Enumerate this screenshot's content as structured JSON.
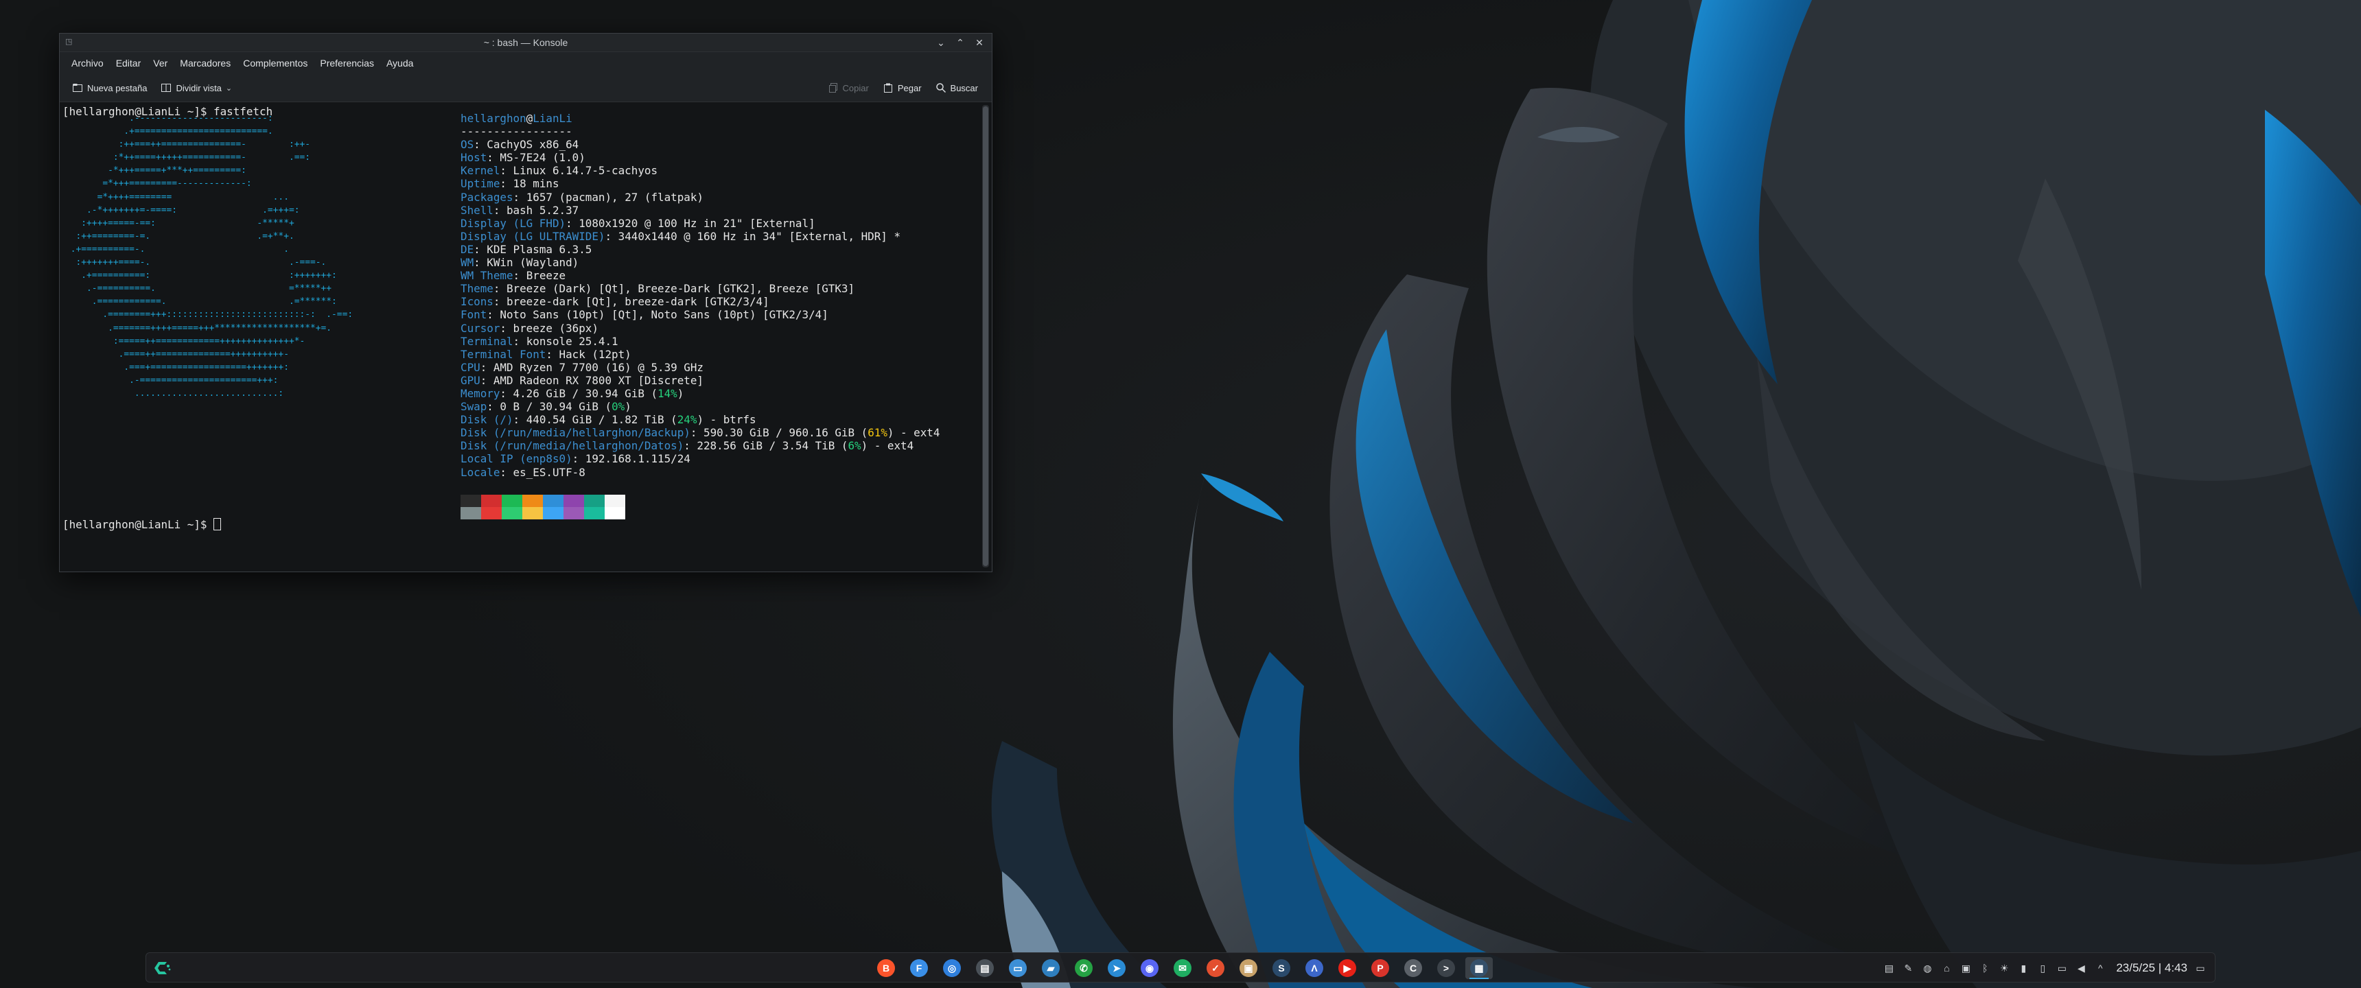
{
  "window": {
    "title": "~ : bash — Konsole",
    "menu": [
      "Archivo",
      "Editar",
      "Ver",
      "Marcadores",
      "Complementos",
      "Preferencias",
      "Ayuda"
    ],
    "toolbar": {
      "new_tab": "Nueva pestaña",
      "split_view": "Dividir vista",
      "copy": "Copiar",
      "paste": "Pegar",
      "search": "Buscar"
    }
  },
  "terminal": {
    "prompt1": "[hellarghon@LianLi ~]$ fastfetch",
    "prompt2": "[hellarghon@LianLi ~]$ ",
    "logo": [
      "            .-------------------------:",
      "           .+=========================.",
      "          :++===++===============-        :++-",
      "         :*++====+++++===========-        .==:",
      "        -*+++=====+***++=========:",
      "       =*+++=========-------------:",
      "      =*++++========                   ...",
      "    .-*+++++++=-====:                .=+++=:",
      "   :++++=====-==:                   -*****+",
      "  :++========-=.                    .=+**+.",
      " .+==========-.                          .",
      "  :+++++++====-.                          .-===-.",
      "   .+==========:                          :+++++++:",
      "    .-==========.                         =*****++",
      "     .============.                       .=******:",
      "       .========+++::::::::::::::::::::::::::-:  .-==:",
      "        .=======++++=====+++*******************+=.",
      "         :=====++============++++++++++++++*-",
      "          .====++==============++++++++++-",
      "           .===+==================+++++++:",
      "            .-======================+++:",
      "             ...........................:"
    ],
    "user": "hellarghon",
    "host": "LianLi",
    "separator": "-----------------",
    "info": [
      {
        "k": "OS",
        "v": "CachyOS x86_64"
      },
      {
        "k": "Host",
        "v": "MS-7E24 (1.0)"
      },
      {
        "k": "Kernel",
        "v": "Linux 6.14.7-5-cachyos"
      },
      {
        "k": "Uptime",
        "v": "18 mins"
      },
      {
        "k": "Packages",
        "v": "1657 (pacman), 27 (flatpak)"
      },
      {
        "k": "Shell",
        "v": "bash 5.2.37"
      },
      {
        "k": "Display (LG FHD)",
        "v": "1080x1920 @ 100 Hz in 21\" [External]"
      },
      {
        "k": "Display (LG ULTRAWIDE)",
        "v": "3440x1440 @ 160 Hz in 34\" [External, HDR] *"
      },
      {
        "k": "DE",
        "v": "KDE Plasma 6.3.5"
      },
      {
        "k": "WM",
        "v": "KWin (Wayland)"
      },
      {
        "k": "WM Theme",
        "v": "Breeze"
      },
      {
        "k": "Theme",
        "v": "Breeze (Dark) [Qt], Breeze-Dark [GTK2], Breeze [GTK3]"
      },
      {
        "k": "Icons",
        "v": "breeze-dark [Qt], breeze-dark [GTK2/3/4]"
      },
      {
        "k": "Font",
        "v": "Noto Sans (10pt) [Qt], Noto Sans (10pt) [GTK2/3/4]"
      },
      {
        "k": "Cursor",
        "v": "breeze (36px)"
      },
      {
        "k": "Terminal",
        "v": "konsole 25.4.1"
      },
      {
        "k": "Terminal Font",
        "v": "Hack (12pt)"
      },
      {
        "k": "CPU",
        "v": "AMD Ryzen 7 7700 (16) @ 5.39 GHz"
      },
      {
        "k": "GPU",
        "v": "AMD Radeon RX 7800 XT [Discrete]"
      },
      {
        "k": "Memory",
        "v": "4.26 GiB / 30.94 GiB (",
        "pct": "14%",
        "pc": "g",
        "post": ")"
      },
      {
        "k": "Swap",
        "v": "0 B / 30.94 GiB (",
        "pct": "0%",
        "pc": "g",
        "post": ")"
      },
      {
        "k": "Disk (/)",
        "v": "440.54 GiB / 1.82 TiB (",
        "pct": "24%",
        "pc": "g",
        "post": ") - btrfs"
      },
      {
        "k": "Disk (/run/media/hellarghon/Backup)",
        "v": "590.30 GiB / 960.16 GiB (",
        "pct": "61%",
        "pc": "y",
        "post": ") - ext4"
      },
      {
        "k": "Disk (/run/media/hellarghon/Datos)",
        "v": "228.56 GiB / 3.54 TiB (",
        "pct": "6%",
        "pc": "g",
        "post": ") - ext4"
      },
      {
        "k": "Local IP (enp8s0)",
        "v": "192.168.1.115/24"
      },
      {
        "k": "Locale",
        "v": "es_ES.UTF-8"
      }
    ],
    "colors_row1": [
      "#2b2b2b",
      "#d32f2f",
      "#1db954",
      "#ef8a17",
      "#2f8fd8",
      "#8e44ad",
      "#16a085",
      "#f5f5f5"
    ],
    "colors_row2": [
      "#7f8c8d",
      "#e53935",
      "#2ecc71",
      "#f6c342",
      "#3da5f5",
      "#9b59b6",
      "#1abc9c",
      "#ffffff"
    ]
  },
  "taskbar": {
    "tasks": [
      {
        "name": "brave-icon",
        "color": "#fb542b",
        "glyph": "B"
      },
      {
        "name": "fedistar-icon",
        "color": "#3a8ee6",
        "glyph": "F"
      },
      {
        "name": "browser-icon",
        "color": "#2f7fdc",
        "glyph": "◎"
      },
      {
        "name": "window-manager-icon",
        "color": "#4a5158",
        "glyph": "▤"
      },
      {
        "name": "folder-icon",
        "color": "#3d8fd6",
        "glyph": "▭"
      },
      {
        "name": "files-icon",
        "color": "#2f7fbf",
        "glyph": "▰"
      },
      {
        "name": "whatsapp-icon",
        "color": "#25a244",
        "glyph": "✆"
      },
      {
        "name": "telegram-icon",
        "color": "#2a8bd4",
        "glyph": "➤"
      },
      {
        "name": "discord-icon",
        "color": "#5865f2",
        "glyph": "◉"
      },
      {
        "name": "mail-icon",
        "color": "#1fae62",
        "glyph": "✉"
      },
      {
        "name": "tasks-icon",
        "color": "#e34f2f",
        "glyph": "✓"
      },
      {
        "name": "archive-icon",
        "color": "#c8a26a",
        "glyph": "▣"
      },
      {
        "name": "steam-icon",
        "color": "#2a4a6b",
        "glyph": "S"
      },
      {
        "name": "vpn-icon",
        "color": "#3c67c9",
        "glyph": "Λ"
      },
      {
        "name": "youtube-icon",
        "color": "#e62117",
        "glyph": "▶"
      },
      {
        "name": "pdf-reader-icon",
        "color": "#d9342b",
        "glyph": "P"
      },
      {
        "name": "cachy-browser-icon",
        "color": "#5b6168",
        "glyph": "C"
      },
      {
        "name": "terminal-icon",
        "color": "#3b4249",
        "glyph": ">"
      },
      {
        "name": "konsole-icon",
        "color": "#35506a",
        "glyph": "▦"
      }
    ],
    "tray": [
      "clipboard-icon",
      "notes-icon",
      "steam-tray-icon",
      "vpn-tray-icon",
      "archive-tray-icon",
      "bluetooth-icon",
      "brightness-icon",
      "battery-icon",
      "disk-icon",
      "display-icon",
      "volume-icon",
      "expand-tray-icon"
    ],
    "clock": "23/5/25 | 4:43"
  }
}
